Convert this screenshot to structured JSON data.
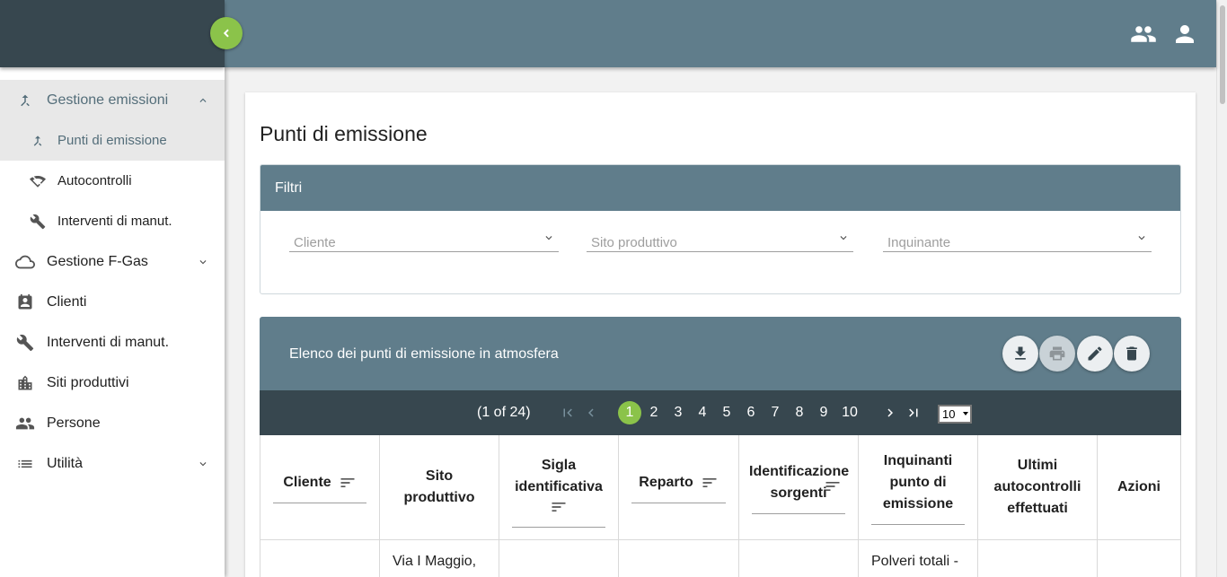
{
  "sidebar": {
    "groups": [
      {
        "label": "Gestione emissioni",
        "icon": "merge-icon",
        "expanded": true,
        "children": [
          {
            "label": "Punti di emissione",
            "icon": "merge-icon",
            "active": true
          },
          {
            "label": "Autocontrolli",
            "icon": "wifi-off-icon"
          },
          {
            "label": "Interventi di manut.",
            "icon": "wrench-icon"
          }
        ]
      },
      {
        "label": "Gestione F-Gas",
        "icon": "cloud-icon"
      },
      {
        "label": "Clienti",
        "icon": "contact-card-icon"
      },
      {
        "label": "Interventi di manut.",
        "icon": "wrench-icon"
      },
      {
        "label": "Siti produttivi",
        "icon": "building-icon"
      },
      {
        "label": "Persone",
        "icon": "people-icon"
      },
      {
        "label": "Utilità",
        "icon": "list-icon"
      }
    ]
  },
  "page": {
    "title": "Punti di emissione"
  },
  "filters": {
    "title": "Filtri",
    "cliente_placeholder": "Cliente",
    "sito_placeholder": "Sito produttivo",
    "inquinante_placeholder": "Inquinante"
  },
  "list": {
    "title": "Elenco dei punti di emissione in atmosfera",
    "actions": [
      "download-icon",
      "print-icon",
      "edit-icon",
      "delete-icon"
    ]
  },
  "paginator": {
    "report": "(1 of 24)",
    "pages": [
      "1",
      "2",
      "3",
      "4",
      "5",
      "6",
      "7",
      "8",
      "9",
      "10"
    ],
    "current": "1",
    "rows_per_page": "10"
  },
  "table": {
    "columns": [
      {
        "label": "Cliente"
      },
      {
        "label": "Sito produttivo"
      },
      {
        "label": "Sigla identificativa"
      },
      {
        "label": "Reparto"
      },
      {
        "label": "Identificazione sorgenti"
      },
      {
        "label": "Inquinanti punto di emissione"
      },
      {
        "label": "Ultimi autocontrolli effettuati"
      },
      {
        "label": "Azioni"
      }
    ],
    "rows": [
      {
        "sito": "Via I Maggio,",
        "inquinanti": "Polveri totali -"
      }
    ]
  },
  "colors": {
    "sidebar_dark": "#37474f",
    "header": "#607d8b",
    "accent": "#8bc34a"
  }
}
